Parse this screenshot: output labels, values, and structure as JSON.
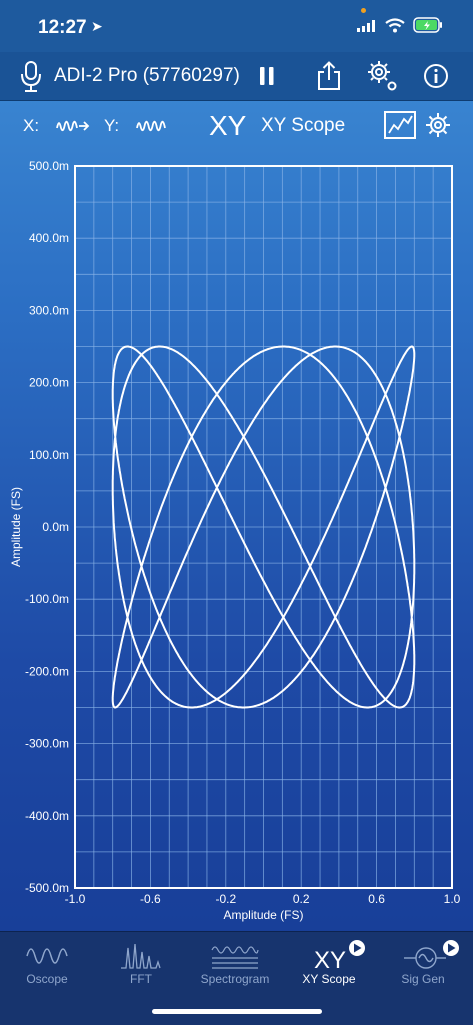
{
  "status": {
    "time": "12:27"
  },
  "toolbar": {
    "device": "ADI-2 Pro (57760297)"
  },
  "channels": {
    "x_label": "X:",
    "y_label": "Y:",
    "mode_short": "XY",
    "mode": "XY Scope"
  },
  "plot": {
    "x_axis_label": "Amplitude (FS)",
    "y_axis_label": "Amplitude (FS)",
    "x_ticks": [
      "-1.0",
      "-0.6",
      "-0.2",
      "0.2",
      "0.6",
      "1.0"
    ],
    "y_ticks": [
      "500.0m",
      "400.0m",
      "300.0m",
      "200.0m",
      "100.0m",
      "0.0m",
      "-100.0m",
      "-200.0m",
      "-300.0m",
      "-400.0m",
      "-500.0m"
    ],
    "x_range": [
      -1.0,
      1.0
    ],
    "y_range": [
      -0.5,
      0.5
    ],
    "trace_color": "#ffffff",
    "grid_color": "#8ab4e8"
  },
  "tabs": [
    {
      "label": "Oscope",
      "icon": "oscilloscope-wave-icon",
      "active": false
    },
    {
      "label": "FFT",
      "icon": "fft-spectrum-icon",
      "active": false
    },
    {
      "label": "Spectrogram",
      "icon": "spectrogram-icon",
      "active": false
    },
    {
      "label": "XY Scope",
      "icon": "xy-scope-icon",
      "active": true
    },
    {
      "label": "Sig Gen",
      "icon": "signal-generator-icon",
      "active": false
    }
  ]
}
